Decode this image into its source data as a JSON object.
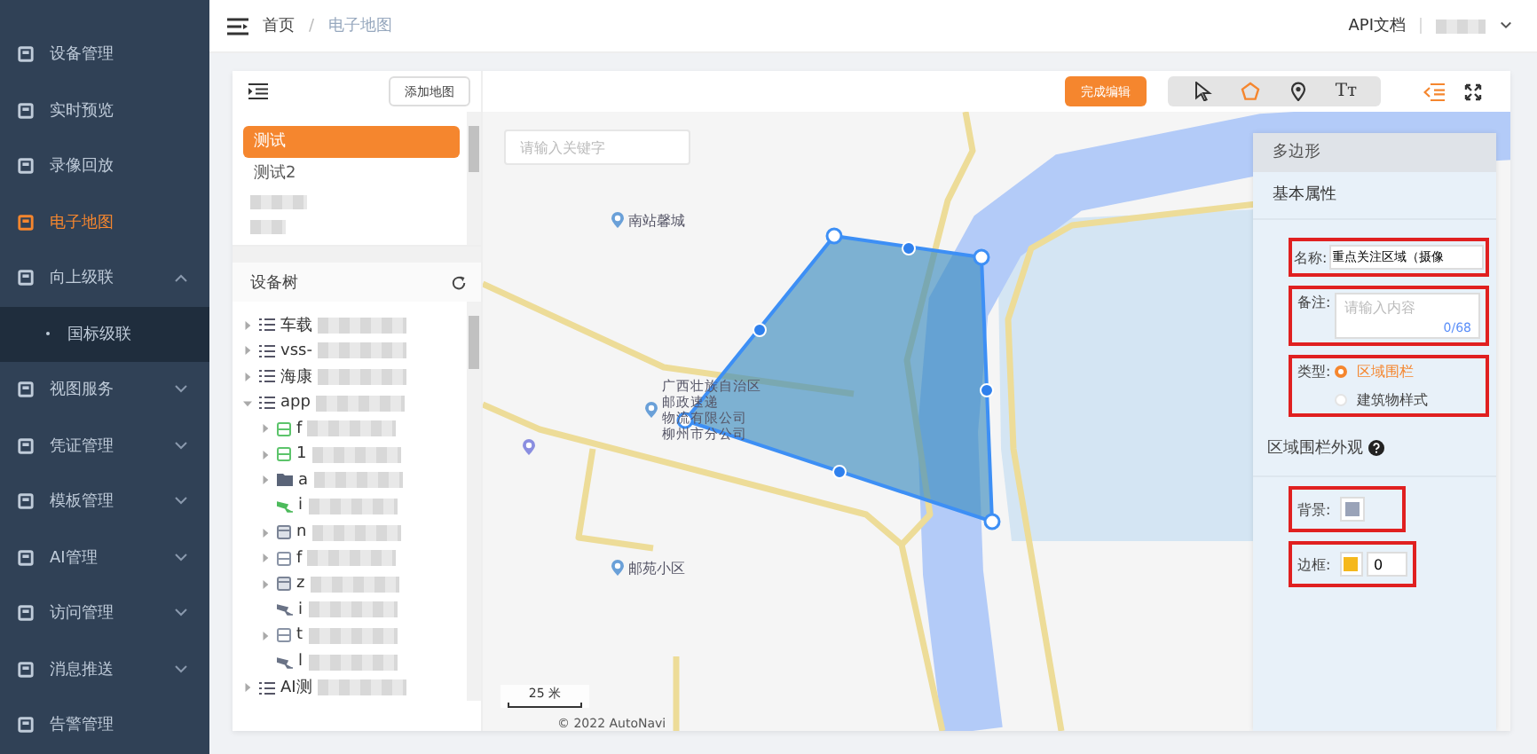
{
  "sidebar": {
    "items": [
      {
        "label": "设备管理",
        "selected": false,
        "expandable": false
      },
      {
        "label": "实时预览",
        "selected": false,
        "expandable": false
      },
      {
        "label": "录像回放",
        "selected": false,
        "expandable": false
      },
      {
        "label": "电子地图",
        "selected": true,
        "expandable": false
      },
      {
        "label": "向上级联",
        "selected": false,
        "expandable": true,
        "expanded": true,
        "children": [
          {
            "label": "国标级联",
            "selected": false
          }
        ]
      },
      {
        "label": "视图服务",
        "selected": false,
        "expandable": true,
        "expanded": false
      },
      {
        "label": "凭证管理",
        "selected": false,
        "expandable": true,
        "expanded": false
      },
      {
        "label": "模板管理",
        "selected": false,
        "expandable": true,
        "expanded": false
      },
      {
        "label": "AI管理",
        "selected": false,
        "expandable": true,
        "expanded": false
      },
      {
        "label": "访问管理",
        "selected": false,
        "expandable": true,
        "expanded": false
      },
      {
        "label": "消息推送",
        "selected": false,
        "expandable": true,
        "expanded": false
      },
      {
        "label": "告警管理",
        "selected": false,
        "expandable": false
      }
    ]
  },
  "header": {
    "breadcrumb": [
      "首页",
      "电子地图"
    ],
    "breadcrumb_separator": "/",
    "api_link": "API文档"
  },
  "map_list": {
    "add_button": "添加地图",
    "items": [
      {
        "label": "测试",
        "selected": true
      },
      {
        "label": "测试2",
        "selected": false
      }
    ]
  },
  "device_tree": {
    "title": "设备树",
    "nodes": [
      {
        "label": "车载",
        "kind": "group",
        "expandable": true,
        "expanded": false
      },
      {
        "label": "vss-",
        "kind": "group",
        "expandable": true,
        "expanded": false
      },
      {
        "label": "海康",
        "kind": "group",
        "expandable": true,
        "expanded": false
      },
      {
        "label": "app",
        "kind": "group",
        "expandable": true,
        "expanded": true,
        "children": [
          {
            "label": "f",
            "kind": "server-online",
            "expandable": true,
            "expanded": false
          },
          {
            "label": "1",
            "kind": "server-online",
            "expandable": true,
            "expanded": false
          },
          {
            "label": "a",
            "kind": "folder",
            "expandable": true,
            "expanded": false
          },
          {
            "label": "i",
            "kind": "camera-online",
            "expandable": false
          },
          {
            "label": "n",
            "kind": "recorder",
            "expandable": true,
            "expanded": false
          },
          {
            "label": "f",
            "kind": "server",
            "expandable": true,
            "expanded": false
          },
          {
            "label": "z",
            "kind": "recorder",
            "expandable": true,
            "expanded": false
          },
          {
            "label": "i",
            "kind": "camera",
            "expandable": false
          },
          {
            "label": "t",
            "kind": "server",
            "expandable": true,
            "expanded": false
          },
          {
            "label": "l",
            "kind": "camera",
            "expandable": false
          }
        ]
      },
      {
        "label": "AI测",
        "kind": "group",
        "expandable": true,
        "expanded": false
      }
    ]
  },
  "map_toolbar": {
    "finish_button": "完成编辑",
    "tools": [
      {
        "kind": "pointer",
        "selected": false
      },
      {
        "kind": "polygon",
        "selected": true
      },
      {
        "kind": "marker",
        "selected": false
      },
      {
        "kind": "text",
        "label": "Tт",
        "selected": false
      }
    ]
  },
  "map": {
    "search_placeholder": "请输入关键字",
    "places": [
      {
        "kind": "poi",
        "lines": [
          "南站馨城"
        ]
      },
      {
        "kind": "poi",
        "lines": [
          "广西壮族自治区",
          "邮政速递",
          "物流有限公司",
          "柳州市分公司"
        ]
      },
      {
        "kind": "poi-bare"
      },
      {
        "kind": "poi",
        "lines": [
          "邮苑小区"
        ]
      }
    ],
    "scale": "25 米",
    "copyright": "© 2022 AutoNavi"
  },
  "properties": {
    "title": "多边形",
    "section": "基本属性",
    "name": {
      "label": "名称:",
      "value": "重点关注区域（摄像"
    },
    "note": {
      "label": "备注:",
      "placeholder": "请输入内容",
      "counter": "0/68"
    },
    "type": {
      "label": "类型:",
      "options": [
        {
          "label": "区域围栏",
          "selected": true
        },
        {
          "label": "建筑物样式",
          "selected": false
        }
      ]
    },
    "appearance_title": "区域围栏外观",
    "background": {
      "label": "背景:",
      "color": "#9aa3b8"
    },
    "border": {
      "label": "边框:",
      "color": "#f5b81c",
      "value": "0"
    }
  }
}
